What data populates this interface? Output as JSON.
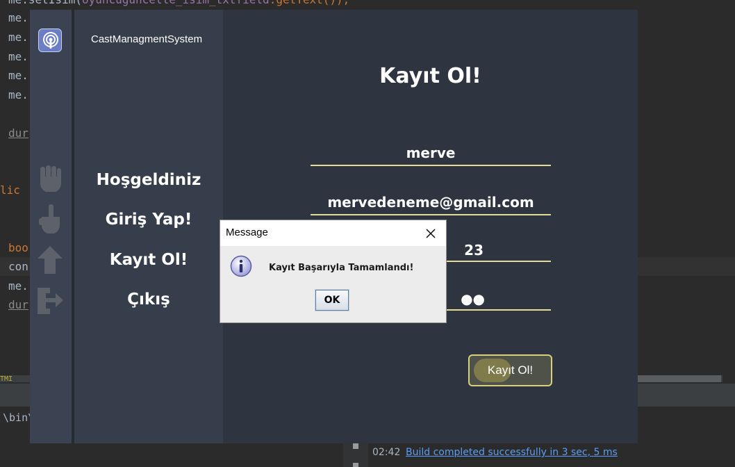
{
  "ide": {
    "top_line_a": "me.setIsim(",
    "top_line_b": "oyuncuguncelle_isim_txtfield",
    "top_line_c": ".getText());",
    "code_lines": [
      "me.",
      "me.",
      "me.",
      "me.",
      "me."
    ],
    "dur_1": "dur",
    "lic": "lic",
    "boo": "boo",
    "con": "con",
    "me_6": "me.",
    "dur_2": "dur",
    "scroll_label": "TMI",
    "bin_path": "\\bin\\",
    "build_time": "02:42",
    "build_message": "Build completed successfully in 3 sec, 5 ms"
  },
  "app": {
    "title": "CastManagmentSystem",
    "menu": {
      "welcome": "Hoşgeldiniz",
      "login": "Giriş Yap!",
      "register": "Kayıt Ol!",
      "exit": "Çıkış"
    },
    "form": {
      "heading": "Kayıt Ol!",
      "name_value": "merve",
      "email_value": "mervedeneme@gmail.com",
      "field3_visible": "23",
      "password_visible": "●●",
      "submit_label": "Kayıt Ol!"
    },
    "colors": {
      "accent": "#e3dc95",
      "rail": "#3b4252",
      "panel": "#363d4b",
      "main": "#2e3440"
    },
    "rail_icons": [
      "fist-icon",
      "point-up-icon",
      "arrow-up-icon",
      "exit-icon"
    ]
  },
  "dialog": {
    "title": "Message",
    "message": "Kayıt Başarıyla Tamamlandı!",
    "ok_label": "OK",
    "icon": "info-icon"
  }
}
